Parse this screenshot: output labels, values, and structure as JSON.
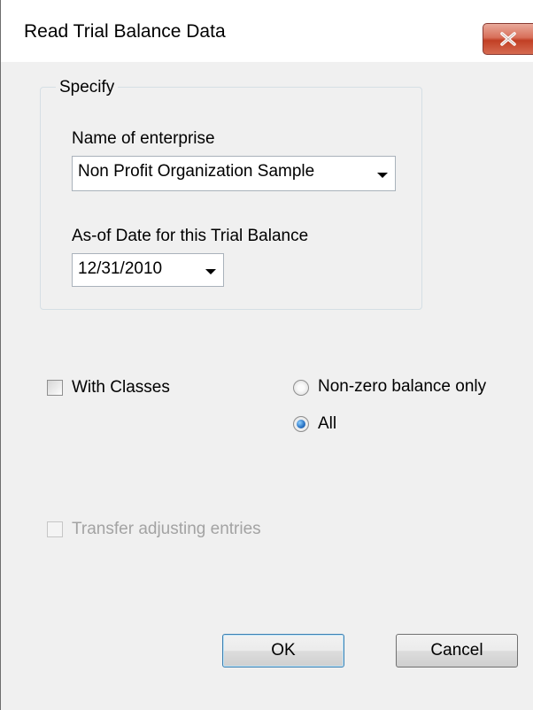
{
  "window": {
    "title": "Read Trial Balance Data",
    "close_icon": "close-icon"
  },
  "specify": {
    "group_label": "Specify",
    "enterprise_label": "Name of enterprise",
    "enterprise_value": "Non Profit Organization Sample",
    "date_label": "As-of Date for this Trial Balance",
    "date_value": "12/31/2010"
  },
  "options": {
    "with_classes_label": "With Classes",
    "with_classes_checked": false,
    "nonzero_label": "Non-zero balance only",
    "all_label": "All",
    "selected_radio": "All",
    "transfer_label": "Transfer adjusting entries",
    "transfer_enabled": false
  },
  "buttons": {
    "ok_label": "OK",
    "cancel_label": "Cancel"
  },
  "colors": {
    "close_button": "#c94a31",
    "dialog_bg": "#f0f0f0",
    "disabled_text": "#a3a3a3"
  }
}
